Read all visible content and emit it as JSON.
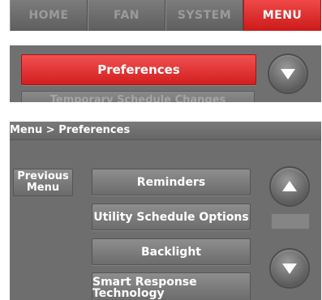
{
  "tabs": [
    {
      "label": "HOME",
      "active": false
    },
    {
      "label": "FAN",
      "active": false
    },
    {
      "label": "SYSTEM",
      "active": false
    },
    {
      "label": "MENU",
      "active": true
    }
  ],
  "panel2": {
    "highlighted_label": "Preferences",
    "next_label": "Temporary Schedule Changes"
  },
  "panel3": {
    "breadcrumb": "Menu > Preferences",
    "previous_menu": {
      "line1": "Previous",
      "line2": "Menu"
    },
    "items": [
      {
        "label": "Reminders"
      },
      {
        "label": "Utility Schedule Options"
      },
      {
        "label": "Backlight"
      },
      {
        "line1": "Smart Response",
        "line2": "Technology"
      }
    ]
  },
  "icons": {
    "scroll_up": "up-arrow-icon",
    "scroll_down": "down-arrow-icon"
  },
  "colors": {
    "active_accent": "#d62424",
    "panel_gray": "#6e6e6e",
    "inactive_tab_text": "#9b9b9b"
  }
}
